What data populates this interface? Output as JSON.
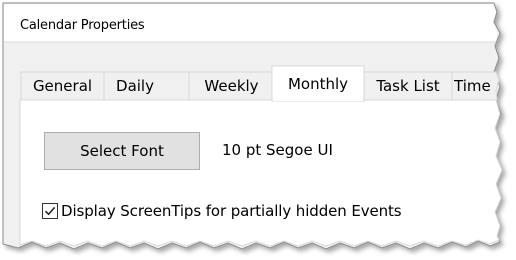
{
  "window": {
    "title": "Calendar Properties"
  },
  "tabs": [
    {
      "label": "General",
      "active": false
    },
    {
      "label": "Daily",
      "active": false
    },
    {
      "label": "Weekly",
      "active": false
    },
    {
      "label": "Monthly",
      "active": true
    },
    {
      "label": "Task List",
      "active": false
    },
    {
      "label": "Time",
      "active": false
    }
  ],
  "monthly": {
    "select_font_label": "Select Font",
    "font_value": "10 pt Segoe UI",
    "screentips_label": "Display ScreenTips for partially hidden Events",
    "screentips_checked": true
  }
}
